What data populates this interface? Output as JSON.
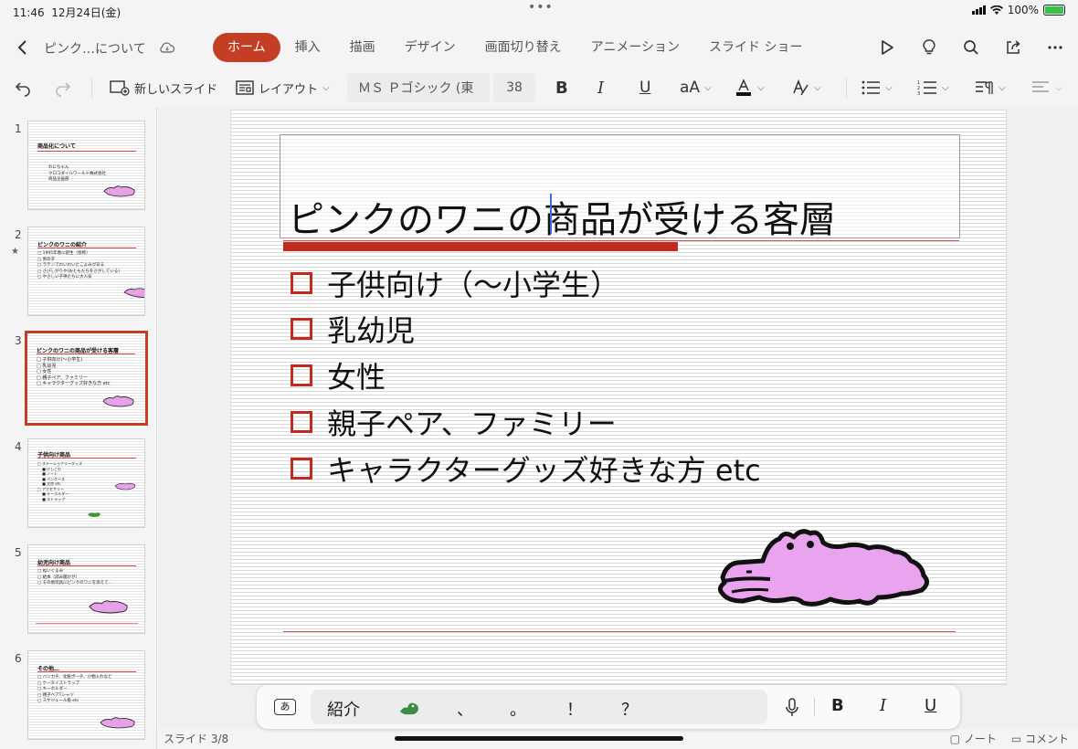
{
  "status": {
    "time": "11:46",
    "date": "12月24日(金)",
    "battery": "100%"
  },
  "app": {
    "doc_title": "ピンク…について"
  },
  "tabs": [
    "ホーム",
    "挿入",
    "描画",
    "デザイン",
    "画面切り替え",
    "アニメーション",
    "スライド ショー"
  ],
  "toolbar": {
    "new_slide": "新しいスライド",
    "layout": "レイアウト",
    "font_name": "ＭＳ Ｐゴシック (東",
    "font_size": "38"
  },
  "thumbnails": [
    {
      "num": "1",
      "title": "商品化について",
      "body": "わにちゃん\nクロコダイルワールド株式会社\n商品企画部"
    },
    {
      "num": "2",
      "title": "ピンクのワニの紹介",
      "body": "□ 1995年春に誕生（仮称）\n□ 男の子\n□ ラテンでわいわいたこよみがある\n□ さびしがりや(おともだちをさがしている)\n□ やさしい子供たちに大人気"
    },
    {
      "num": "3",
      "title": "ピンクのワニの商品が受ける客層",
      "body": "□ 子供向け(～小学生)\n□ 乳幼児\n□ 女性\n□ 親子ペア、ファミリー\n□ キャラクターグッズ好きな方 etc"
    },
    {
      "num": "4",
      "title": "子供向け商品",
      "body": "□ ステーショナリーグッズ\n    ■ けしごむ\n    ■ ノート\n    ■ ペンケース\n    ■ 文房 etc\n□ アクセサリー\n    ■ キーホルダー\n    ■ ストラップ"
    },
    {
      "num": "5",
      "title": "幼児向け商品",
      "body": "□ ぬいぐるみ\n□ 絵本（読み聞かせ）\n□ その他玩具にピンクのワニを添えて…"
    },
    {
      "num": "6",
      "title": "その他…",
      "body": "□ ハンカチ、化粧ポーチ、小物入れなど\n□ ケータイストラップ\n□ キーホルダー\n□ 親子ペアTシャツ\n□ スケジュール帳 etc"
    }
  ],
  "slide": {
    "title": "ピンクのワニの商品が受ける客層",
    "bullets": [
      "子供向け（～小学生）",
      "乳幼児",
      "女性",
      "親子ペア、ファミリー",
      "キャラクターグッズ好きな方 etc"
    ]
  },
  "keyboard": {
    "kana_key": "あ",
    "suggestions": [
      "紹介",
      "、",
      "。",
      "！",
      "？"
    ]
  },
  "footer": {
    "slide_counter": "スライド 3/8",
    "notes": "ノート",
    "comments": "コメント"
  },
  "colors": {
    "accent": "#c23f25",
    "slide_red": "#c12b1e",
    "croc_pink": "#e8a0e8"
  }
}
